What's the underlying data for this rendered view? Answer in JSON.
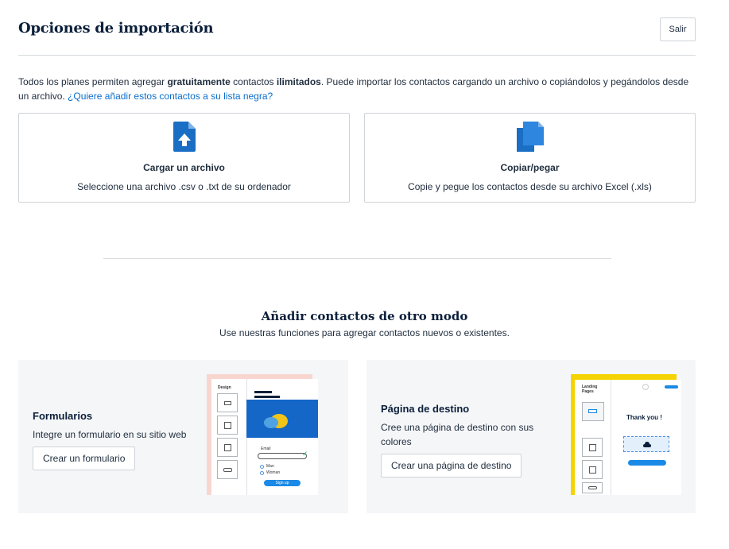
{
  "header": {
    "title": "Opciones de importación",
    "exit_label": "Salir"
  },
  "intro": {
    "part1": "Todos los planes permiten agregar ",
    "bold1": "gratuitamente",
    "part2": " contactos ",
    "bold2": "ilimitados",
    "part3": ". Puede importar los contactos cargando un archivo o copiándolos y pegándolos desde un archivo. ",
    "link": "¿Quiere añadir estos contactos a su lista negra?"
  },
  "import_options": [
    {
      "title": "Cargar un archivo",
      "description": "Seleccione una archivo .csv o .txt de su ordenador",
      "icon": "file-upload-icon"
    },
    {
      "title": "Copiar/pegar",
      "description": "Copie y pegue los contactos desde su archivo Excel (.xls)",
      "icon": "copy-icon"
    }
  ],
  "other_ways": {
    "title": "Añadir contactos de otro modo",
    "subtitle": "Use nuestras funciones para agregar contactos nuevos o existentes."
  },
  "features": [
    {
      "title": "Formularios",
      "description": "Integre un formulario en su sitio web",
      "button": "Crear un formulario",
      "preview": {
        "heading": "Design",
        "field_label": "Email",
        "option1": "Man",
        "option2": "Woman",
        "submit": "Sign up"
      }
    },
    {
      "title": "Página de destino",
      "description": "Cree una página de destino con sus colores",
      "button": "Crear una página de destino",
      "preview": {
        "heading": "Landing Pages",
        "headline": "Thank you !"
      }
    }
  ],
  "colors": {
    "accent": "#0a6ecc",
    "icon_blue": "#1a6fc4",
    "title_navy": "#0b1f3a",
    "card_bg": "#f5f6f8"
  }
}
